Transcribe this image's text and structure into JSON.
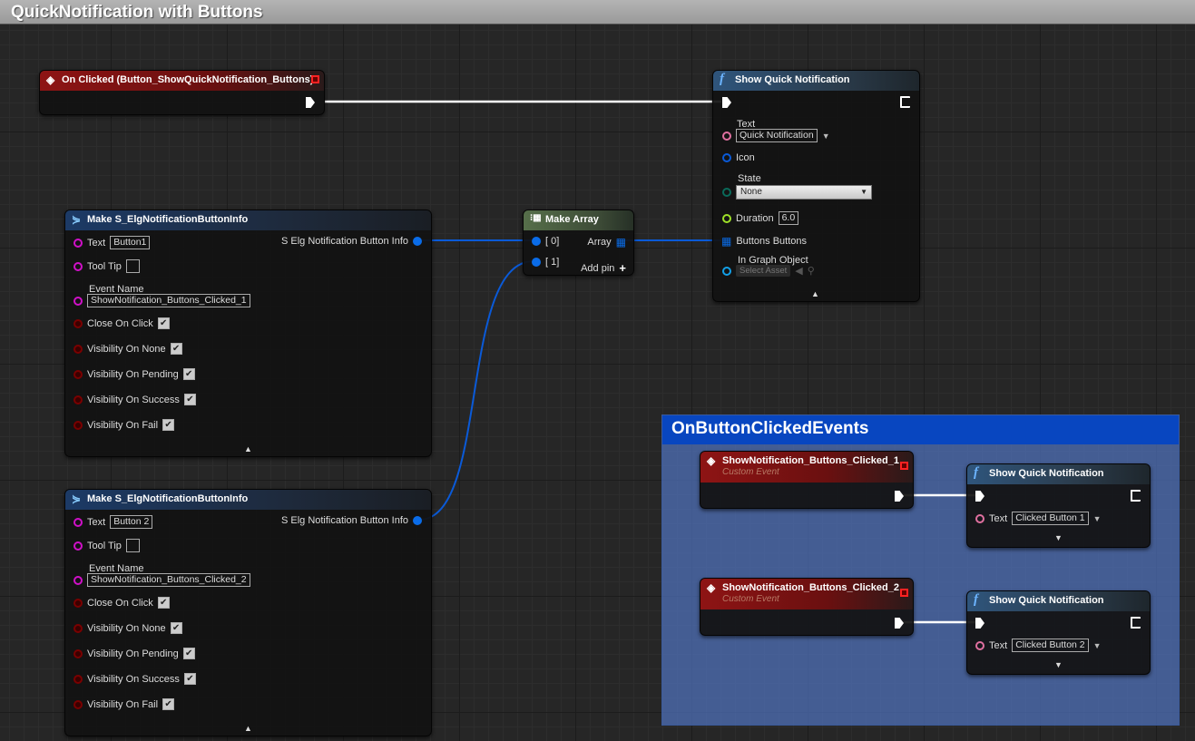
{
  "title": "QuickNotification with Buttons",
  "colors": {
    "exec": "#ffffff",
    "text_pin": "#e070a0",
    "struct_pin": "#0a6ce8",
    "name_pin": "#d010c8",
    "bool_pin": "#8a0000",
    "float_pin": "#9ee028",
    "byte_pin": "#0a6a5a",
    "object_pin": "#12a0e8",
    "comment_header": "#0846c0"
  },
  "event_node": {
    "title": "On Clicked (Button_ShowQuickNotification_Buttons)",
    "icon": "event-diamond-icon"
  },
  "show_notification": {
    "title": "Show Quick Notification",
    "icon": "function-icon",
    "text_label": "Text",
    "text_value": "Quick Notification",
    "icon_label": "Icon",
    "state_label": "State",
    "state_value": "None",
    "duration_label": "Duration",
    "duration_value": "6.0",
    "buttons_label": "Buttons Buttons",
    "object_label": "In Graph Object",
    "object_value": "Select Asset"
  },
  "make_array": {
    "title": "Make Array",
    "pin0": "[ 0]",
    "pin1": "[ 1]",
    "output": "Array",
    "add_pin": "Add pin"
  },
  "structs": [
    {
      "title": "Make S_ElgNotificationButtonInfo",
      "output": "S Elg Notification Button Info",
      "text_label": "Text",
      "text_value": "Button1",
      "tooltip_label": "Tool Tip",
      "event_label": "Event Name",
      "event_value": "ShowNotification_Buttons_Clicked_1",
      "bools": [
        {
          "label": "Close On Click",
          "checked": true
        },
        {
          "label": "Visibility On None",
          "checked": true
        },
        {
          "label": "Visibility On Pending",
          "checked": true
        },
        {
          "label": "Visibility On Success",
          "checked": true
        },
        {
          "label": "Visibility On Fail",
          "checked": true
        }
      ]
    },
    {
      "title": "Make S_ElgNotificationButtonInfo",
      "output": "S Elg Notification Button Info",
      "text_label": "Text",
      "text_value": "Button 2",
      "tooltip_label": "Tool Tip",
      "event_label": "Event Name",
      "event_value": "ShowNotification_Buttons_Clicked_2",
      "bools": [
        {
          "label": "Close On Click",
          "checked": true
        },
        {
          "label": "Visibility On None",
          "checked": true
        },
        {
          "label": "Visibility On Pending",
          "checked": true
        },
        {
          "label": "Visibility On Success",
          "checked": true
        },
        {
          "label": "Visibility On Fail",
          "checked": true
        }
      ]
    }
  ],
  "comment": {
    "title": "OnButtonClickedEvents"
  },
  "custom_events": [
    {
      "title": "ShowNotification_Buttons_Clicked_1",
      "subtitle": "Custom Event",
      "call_title": "Show Quick Notification",
      "text_label": "Text",
      "text_value": "Clicked Button 1"
    },
    {
      "title": "ShowNotification_Buttons_Clicked_2",
      "subtitle": "Custom Event",
      "call_title": "Show Quick Notification",
      "text_label": "Text",
      "text_value": "Clicked Button 2"
    }
  ]
}
